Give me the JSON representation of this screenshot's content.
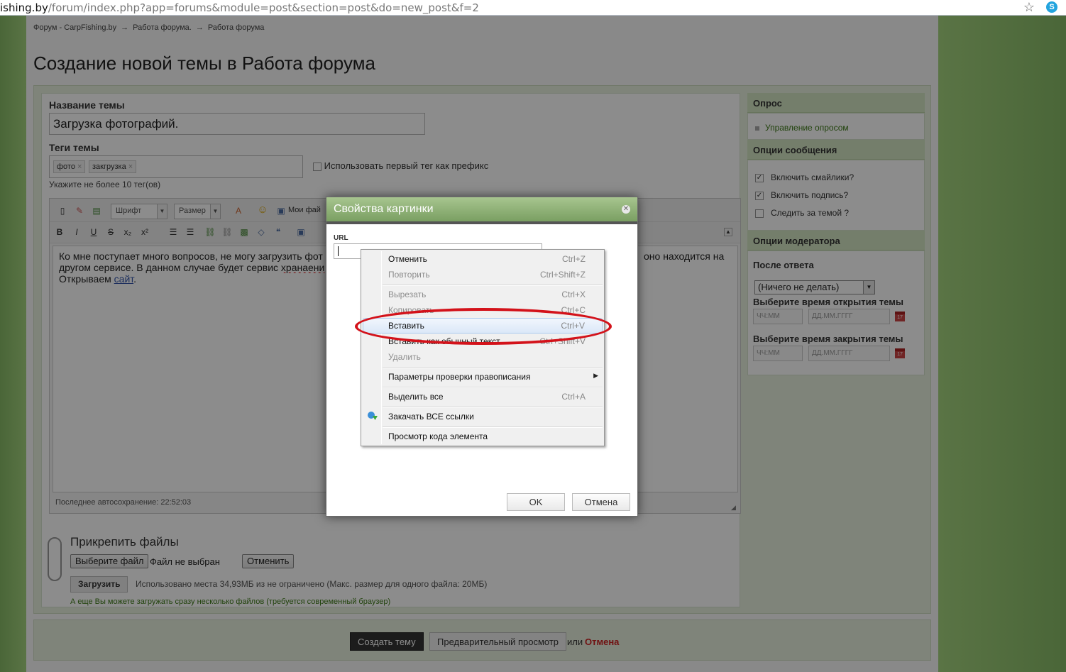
{
  "browser": {
    "url_domain": "ishing.by",
    "url_path": "/forum/index.php?app=forums&module=post&section=post&do=new_post&f=2"
  },
  "breadcrumb": [
    "Форум - CarpFishing.by",
    "Работа форума.",
    "Работа форума"
  ],
  "breadcrumb_sep": "→",
  "page_title": "Создание новой темы в Работа форума",
  "form": {
    "title_label": "Название темы",
    "title_value": "Загрузка фотографий.",
    "tags_label": "Теги темы",
    "tags": [
      "фото",
      "закгрузка"
    ],
    "tag_remove": "×",
    "prefix_label": "Использовать первый тег как префикс",
    "tags_hint": "Укажите не более 10 тег(ов)"
  },
  "editor": {
    "font_select": "Шрифт",
    "size_select": "Размер",
    "my_files": "Мои фай",
    "text_line1": "Ко мне поступает много вопросов, не могу загрузить фот",
    "text_line1_end": "оно находится на",
    "text_line2_start": "другом сервисе. В данном случае будет сервис ",
    "text_line2_spell": "хранаени",
    "text_line3_start": "Открываем ",
    "text_line3_link": "сайт",
    "text_line3_end": ".",
    "autosave": "Последнее автосохранение: 22:52:03"
  },
  "attachments": {
    "title": "Прикрепить файлы",
    "choose_file": "Выберите файл",
    "no_file": "Файл не выбран",
    "cancel": "Отменить",
    "upload": "Загрузить",
    "space_info": "Использовано места 34,93МБ из не ограничено (Макс. размер для одного файла: 20МБ)",
    "multi_info": "А еще Вы можете загружать сразу несколько файлов (требуется современный браузер)"
  },
  "sidebar": {
    "poll_head": "Опрос",
    "poll_link": "Управление опросом",
    "options_head": "Опции сообщения",
    "options": [
      {
        "label": "Включить смайлики?",
        "checked": true
      },
      {
        "label": "Включить подпись?",
        "checked": true
      },
      {
        "label": "Следить за темой ?",
        "checked": false
      }
    ],
    "mod_head": "Опции модератора",
    "after_reply_label": "После ответа",
    "after_reply_value": "(Ничего не делать)",
    "open_time_label": "Выберите время открытия темы",
    "close_time_label": "Выберите время закрытия темы",
    "time_placeholder": "ЧЧ:ММ",
    "date_placeholder": "ДД.ММ.ГГГГ"
  },
  "submit": {
    "create": "Создать тему",
    "preview": "Предварительный просмотр",
    "or": "или",
    "cancel": "Отмена"
  },
  "dialog": {
    "title": "Свойства картинки",
    "url_label": "URL",
    "ok": "OK",
    "cancel": "Отмена"
  },
  "context_menu": {
    "items": [
      {
        "label": "Отменить",
        "key": "Ctrl+Z",
        "disabled": false
      },
      {
        "label": "Повторить",
        "key": "Ctrl+Shift+Z",
        "disabled": true
      },
      {
        "label": "Вырезать",
        "key": "Ctrl+X",
        "disabled": true
      },
      {
        "label": "Копировать",
        "key": "Ctrl+C",
        "disabled": true
      },
      {
        "label": "Вставить",
        "key": "Ctrl+V",
        "disabled": false
      },
      {
        "label": "Вставить как обычный текст",
        "key": "Ctrl+Shift+V",
        "disabled": false
      },
      {
        "label": "Удалить",
        "key": "",
        "disabled": true
      },
      {
        "label": "Параметры проверки правописания",
        "key": "",
        "disabled": false
      },
      {
        "label": "Выделить все",
        "key": "Ctrl+A",
        "disabled": false
      },
      {
        "label": "Закачать ВСЕ ссылки",
        "key": "",
        "disabled": false
      },
      {
        "label": "Просмотр кода элемента",
        "key": "",
        "disabled": false
      }
    ]
  },
  "colors": {
    "accent_green": "#7a9f62",
    "annotation_red": "#d3121a",
    "cancel_red": "#cc2222"
  }
}
